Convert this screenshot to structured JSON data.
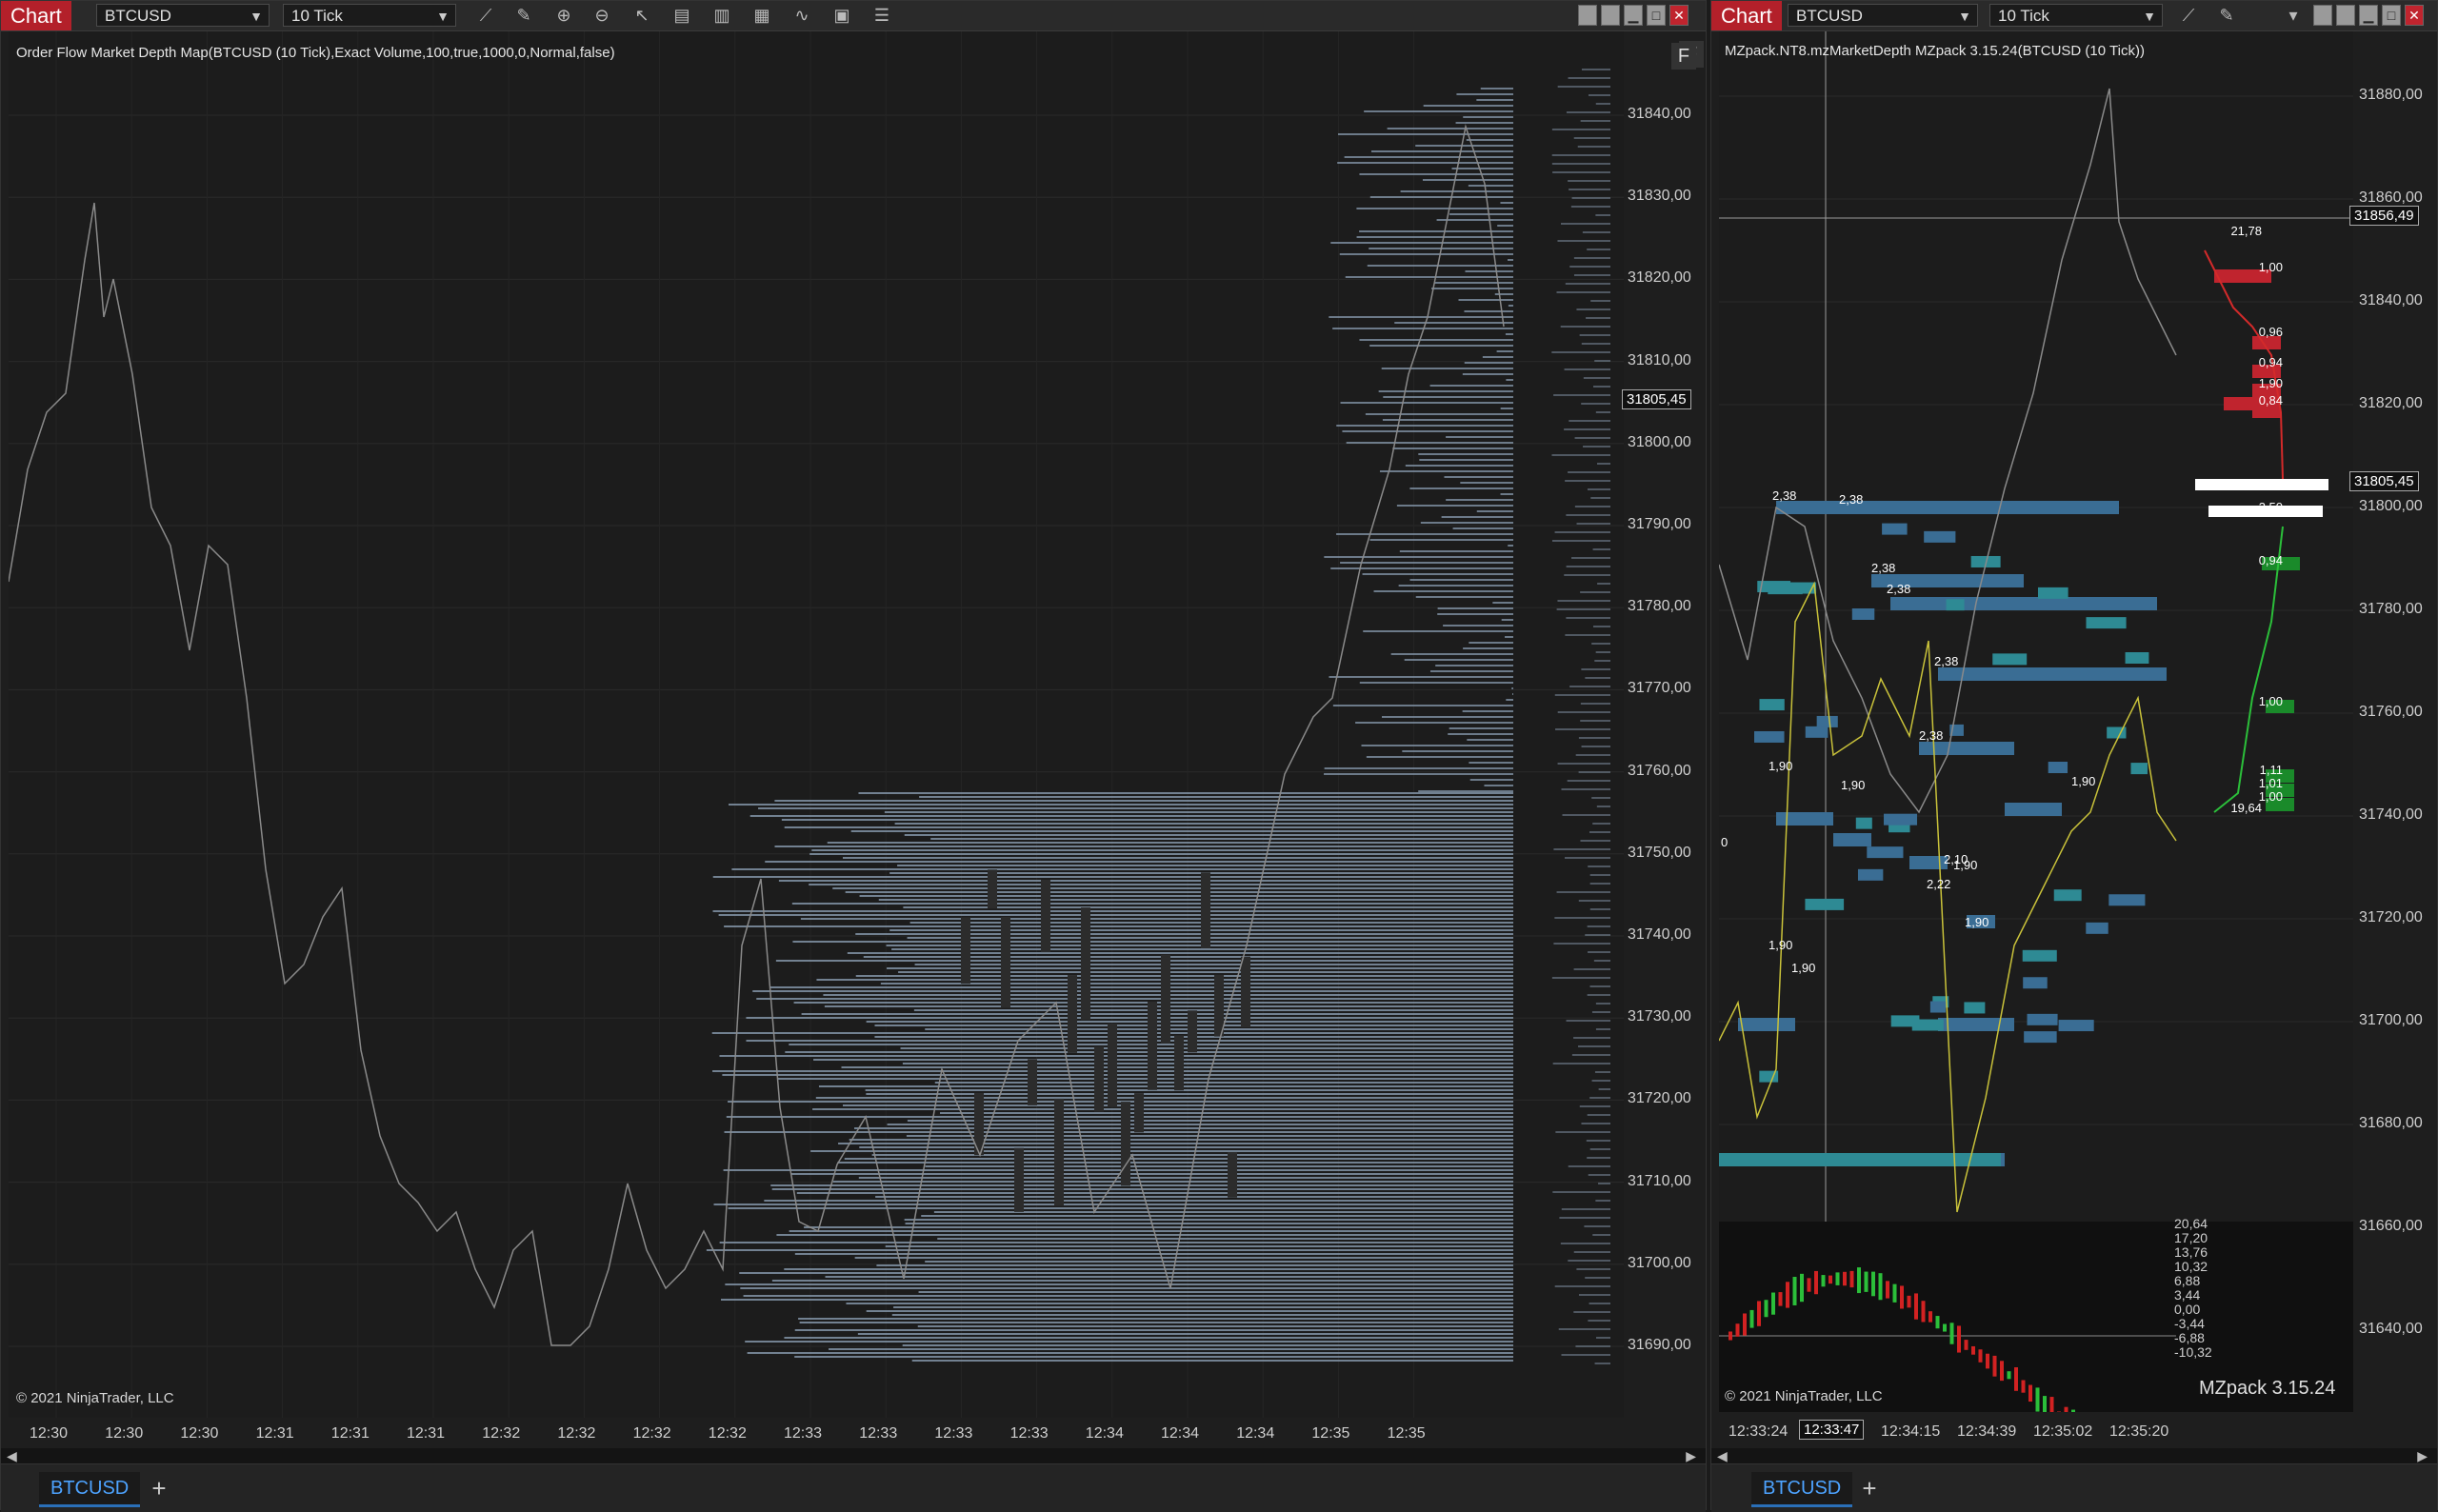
{
  "left": {
    "chart_tag": "Chart",
    "instrument": "BTCUSD",
    "interval": "10 Tick",
    "indicator_label": "Order Flow Market Depth Map(BTCUSD (10 Tick),Exact Volume,100,true,1000,0,Normal,false)",
    "copyright": "© 2021 NinjaTrader, LLC",
    "f_button": "F",
    "last_price": "31805,45",
    "price_ticks": [
      "31840,00",
      "31830,00",
      "31820,00",
      "31810,00",
      "31800,00",
      "31790,00",
      "31780,00",
      "31770,00",
      "31760,00",
      "31750,00",
      "31740,00",
      "31730,00",
      "31720,00",
      "31710,00",
      "31700,00",
      "31690,00"
    ],
    "time_ticks": [
      "12:30",
      "12:30",
      "12:30",
      "12:31",
      "12:31",
      "12:31",
      "12:32",
      "12:32",
      "12:32",
      "12:32",
      "12:33",
      "12:33",
      "12:33",
      "12:33",
      "12:34",
      "12:34",
      "12:34",
      "12:35",
      "12:35"
    ],
    "tab_label": "BTCUSD",
    "tab_add": "+"
  },
  "right": {
    "chart_tag": "Chart",
    "instrument": "BTCUSD",
    "interval": "10 Tick",
    "indicator_label": "MZpack.NT8.mzMarketDepth MZpack 3.15.24(BTCUSD (10 Tick))",
    "copyright": "© 2021 NinjaTrader, LLC",
    "watermark": "MZpack 3.15.24",
    "last_price": "31805,45",
    "crosshair_price": "31856,49",
    "crosshair_time": "12:33:47",
    "price_ticks": [
      "31880,00",
      "31860,00",
      "31840,00",
      "31820,00",
      "31800,00",
      "31780,00",
      "31760,00",
      "31740,00",
      "31720,00",
      "31700,00",
      "31680,00",
      "31660,00",
      "31640,00"
    ],
    "osc_ticks": [
      "20,64",
      "17,20",
      "13,76",
      "10,32",
      "6,88",
      "3,44",
      "0,00",
      "-3,44",
      "-6,88",
      "-10,32"
    ],
    "time_ticks": [
      "12:33:24",
      "12:33:47",
      "12:34:15",
      "12:34:39",
      "12:35:02",
      "12:35:20"
    ],
    "dom_labels": [
      "21,78",
      "1,00",
      "0,96",
      "0,94",
      "1,90",
      "0,84",
      "3,50",
      "0,94",
      "1,00",
      "1,11",
      "1,01",
      "1,00",
      "19,64"
    ],
    "heat_labels": [
      "2,38",
      "2,38",
      "2,38",
      "2,38",
      "2,38",
      "2,38",
      "1,90",
      "1,90",
      "1,90",
      "2,10",
      "1,90",
      "2,22",
      "1,90",
      "1,90",
      "1,90",
      "0"
    ],
    "tab_label": "BTCUSD",
    "tab_add": "+"
  }
}
